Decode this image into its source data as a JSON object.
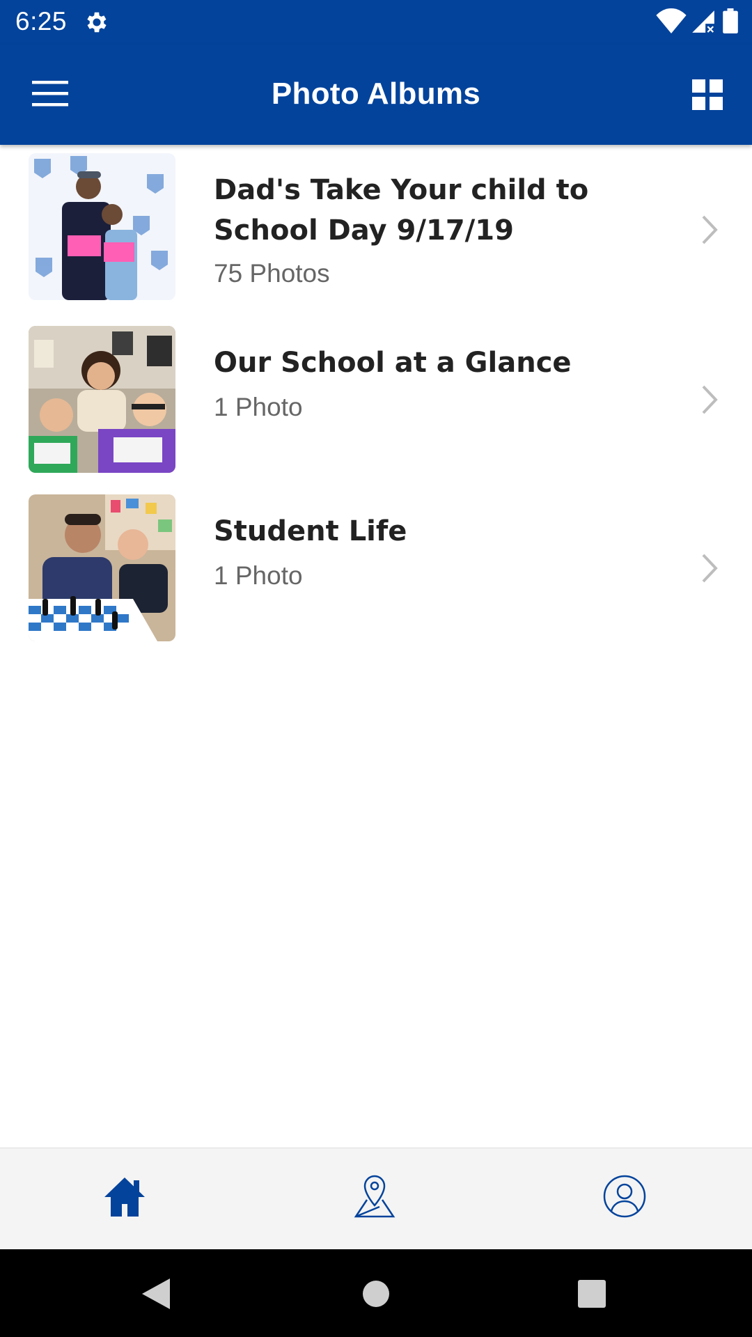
{
  "status_bar": {
    "time": "6:25",
    "icons": [
      "gear-icon",
      "wifi-icon",
      "signal-icon",
      "battery-icon"
    ]
  },
  "app_bar": {
    "title": "Photo Albums",
    "left_icon": "hamburger-menu-icon",
    "right_icon": "grid-view-icon",
    "background_color": "#03439b"
  },
  "albums": [
    {
      "title": "Dad's Take Your child to School Day 9/17/19",
      "count": "75 Photos",
      "thumbnail": "album-thumbnail"
    },
    {
      "title": "Our School at a Glance",
      "count": "1 Photo",
      "thumbnail": "album-thumbnail"
    },
    {
      "title": "Student Life",
      "count": "1 Photo",
      "thumbnail": "album-thumbnail"
    }
  ],
  "bottom_nav": {
    "items": [
      "home-icon",
      "map-pin-icon",
      "profile-icon"
    ],
    "active": "home-icon",
    "accent_color": "#03439b"
  },
  "system_nav": [
    "back-icon",
    "home-circle-icon",
    "recents-icon"
  ]
}
